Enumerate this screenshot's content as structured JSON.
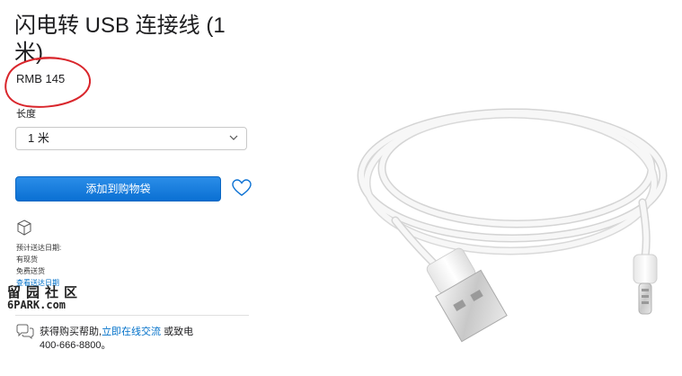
{
  "product": {
    "title": "闪电转 USB 连接线 (1 米)",
    "price": "RMB 145"
  },
  "length": {
    "label": "长度",
    "selected": "1 米"
  },
  "actions": {
    "add_to_bag": "添加到购物袋"
  },
  "shipping": {
    "heading": "预计送达日期:",
    "in_stock": "有现货",
    "free_shipping": "免费送货",
    "check_link": "查看送达日期"
  },
  "watermark": {
    "cn": "留园社区",
    "url": "6PARK.com"
  },
  "help": {
    "prefix": "获得购买帮助,",
    "link": "立即在线交流",
    "middle": "或致电",
    "phone": "400-666-8800。"
  },
  "icons": [
    "chevron-down-icon",
    "heart-icon",
    "box-icon",
    "chat-icon"
  ],
  "colors": {
    "button_blue": "#0a70d3",
    "link_blue": "#0070c9",
    "annotation_red": "#d9262c"
  }
}
